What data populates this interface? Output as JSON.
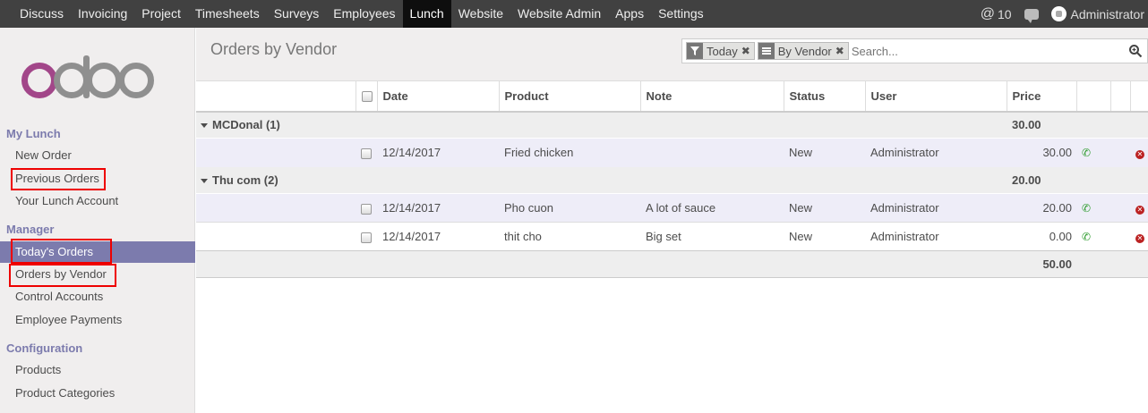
{
  "topnav": {
    "items": [
      "Discuss",
      "Invoicing",
      "Project",
      "Timesheets",
      "Surveys",
      "Employees",
      "Lunch",
      "Website",
      "Website Admin",
      "Apps",
      "Settings"
    ],
    "active": "Lunch",
    "mention_count": "10",
    "user": "Administrator"
  },
  "sidebar": {
    "sections": [
      {
        "title": "My Lunch",
        "items": [
          "New Order",
          "Previous Orders",
          "Your Lunch Account"
        ]
      },
      {
        "title": "Manager",
        "items": [
          "Today's Orders",
          "Orders by Vendor",
          "Control Accounts",
          "Employee Payments"
        ]
      },
      {
        "title": "Configuration",
        "items": [
          "Products",
          "Product Categories"
        ]
      }
    ],
    "active_item": "Today's Orders"
  },
  "page": {
    "title": "Orders by Vendor",
    "facets": [
      "Today",
      "By Vendor"
    ],
    "search_placeholder": "Search..."
  },
  "table": {
    "columns": [
      "Date",
      "Product",
      "Note",
      "Status",
      "User",
      "Price"
    ],
    "groups": [
      {
        "label": "MCDonal (1)",
        "total": "30.00",
        "rows": [
          {
            "date": "12/14/2017",
            "product": "Fried chicken",
            "note": "",
            "status": "New",
            "user": "Administrator",
            "price": "30.00"
          }
        ]
      },
      {
        "label": "Thu com (2)",
        "total": "20.00",
        "rows": [
          {
            "date": "12/14/2017",
            "product": "Pho cuon",
            "note": "A lot of sauce",
            "status": "New",
            "user": "Administrator",
            "price": "20.00"
          },
          {
            "date": "12/14/2017",
            "product": "thit cho",
            "note": "Big set",
            "status": "New",
            "user": "Administrator",
            "price": "0.00"
          }
        ]
      }
    ],
    "grand_total": "50.00"
  },
  "colors": {
    "topbar": "#414141",
    "accent": "#7c7bad",
    "highlight_box": "#e00000",
    "odoo_o": "#a24689"
  }
}
